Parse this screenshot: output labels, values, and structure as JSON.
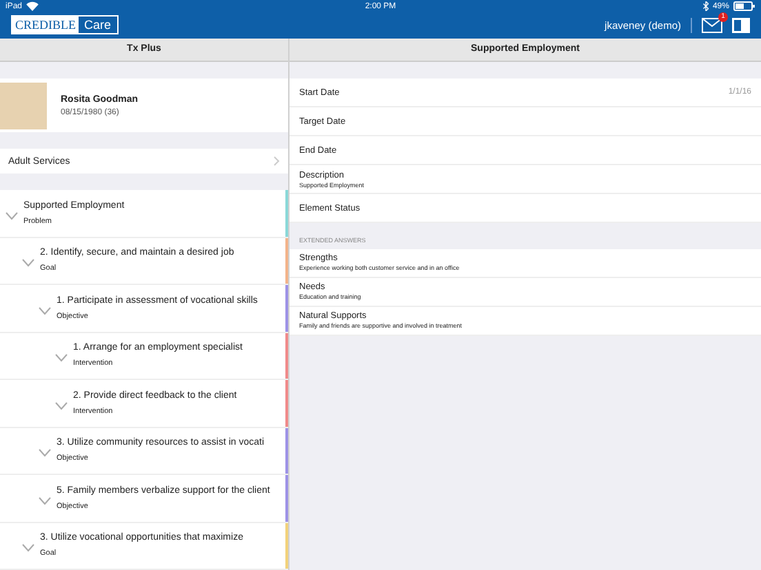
{
  "status_bar": {
    "device": "iPad",
    "time": "2:00 PM",
    "battery": "49%"
  },
  "nav": {
    "logo_left": "CREDIBLE",
    "logo_right": "Care",
    "user": "jkaveney (demo)",
    "badge": "1"
  },
  "left": {
    "title": "Tx Plus",
    "patient": {
      "name": "Rosita Goodman",
      "dob": "08/15/1980 (36)"
    },
    "program": "Adult Services",
    "tree": [
      {
        "title": "Supported Employment",
        "type": "Problem",
        "expanded": true,
        "color": "#8ad8d8",
        "children": [
          {
            "title": "2. Identify, secure, and maintain a desired job",
            "type": "Goal",
            "expanded": true,
            "color": "#f3b38a",
            "children": [
              {
                "title": "1. Participate in assessment of vocational skills",
                "type": "Objective",
                "expanded": true,
                "color": "#9d92e6",
                "children": [
                  {
                    "title": "1. Arrange for an employment specialist",
                    "type": "Intervention",
                    "expanded": true,
                    "color": "#f08a8a"
                  },
                  {
                    "title": "2. Provide direct feedback to the client",
                    "type": "Intervention",
                    "expanded": true,
                    "color": "#f08a8a"
                  }
                ]
              },
              {
                "title": "3. Utilize community resources to assist in vocati",
                "type": "Objective",
                "expanded": true,
                "color": "#9d92e6"
              },
              {
                "title": "5. Family members verbalize support for the client",
                "type": "Objective",
                "expanded": true,
                "color": "#9d92e6"
              }
            ]
          },
          {
            "title": "3. Utilize vocational opportunities that maximize",
            "type": "Goal",
            "expanded": true,
            "color": "#f2d27a"
          }
        ]
      }
    ]
  },
  "right": {
    "title": "Supported Employment",
    "fields": [
      {
        "label": "Start Date",
        "value": "1/1/16"
      },
      {
        "label": "Target Date"
      },
      {
        "label": "End Date"
      },
      {
        "label": "Description",
        "detail": "Supported Employment"
      },
      {
        "label": "Element Status"
      }
    ],
    "section": "EXTENDED ANSWERS",
    "answers": [
      {
        "label": "Strengths",
        "detail": "Experience working both customer service and in an office"
      },
      {
        "label": "Needs",
        "detail": "Education and training"
      },
      {
        "label": "Natural Supports",
        "detail": "Family and friends are supportive and involved in treatment"
      }
    ]
  }
}
